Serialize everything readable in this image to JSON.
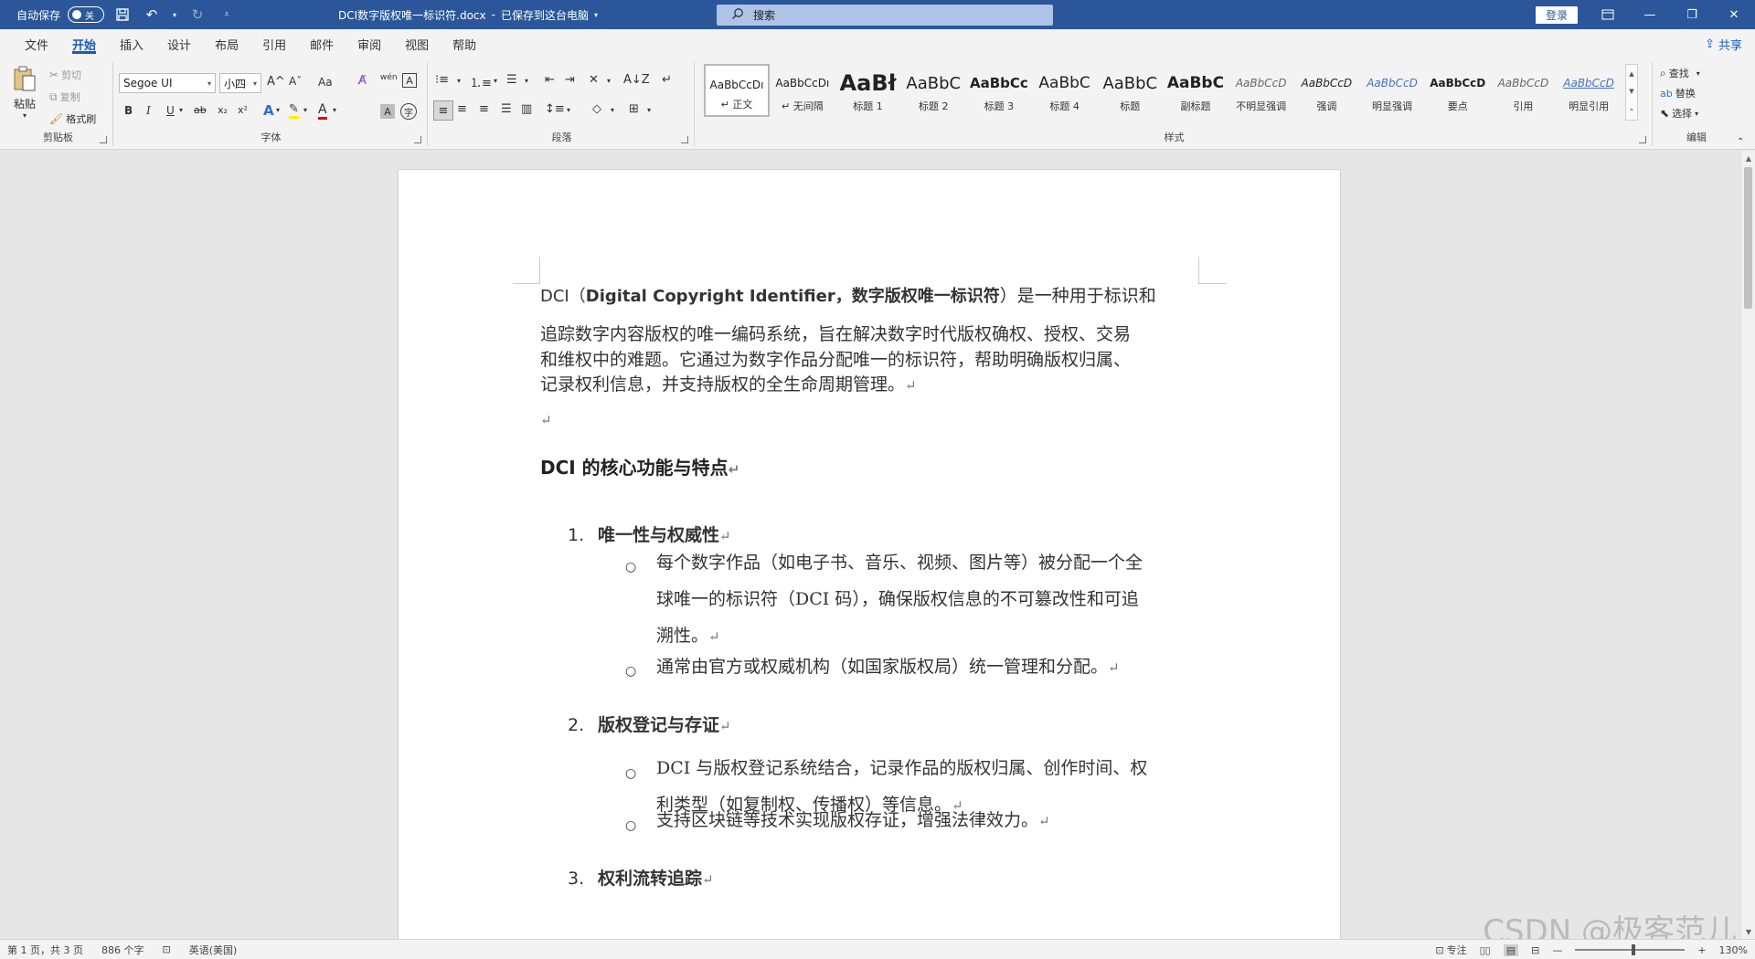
{
  "titlebar": {
    "autosave_label": "自动保存",
    "autosave_state": "关",
    "doc_title": "DCI数字版权唯一标识符.docx",
    "saved_status": "已保存到这台电脑",
    "search_placeholder": "搜索",
    "login_label": "登录"
  },
  "menu": {
    "tabs": [
      "文件",
      "开始",
      "插入",
      "设计",
      "布局",
      "引用",
      "邮件",
      "审阅",
      "视图",
      "帮助"
    ],
    "share_label": "共享"
  },
  "ribbon": {
    "clipboard": {
      "paste": "粘贴",
      "cut": "剪切",
      "copy": "复制",
      "format_painter": "格式刷",
      "label": "剪贴板"
    },
    "font": {
      "font_name": "Segoe UI",
      "font_size": "小四",
      "grow": "A^",
      "shrink": "Aˇ",
      "case": "Aa",
      "bold": "B",
      "italic": "I",
      "underline": "U",
      "strike": "ab",
      "subscript": "x₂",
      "superscript": "x²",
      "label": "字体"
    },
    "paragraph": {
      "label": "段落"
    },
    "styles": {
      "label": "样式",
      "items": [
        {
          "sample": "AaBbCcDı",
          "name": "↵ 正文"
        },
        {
          "sample": "AaBbCcDı",
          "name": "↵ 无间隔"
        },
        {
          "sample": "AaBł",
          "name": "标题 1"
        },
        {
          "sample": "AaBbC",
          "name": "标题 2"
        },
        {
          "sample": "AaBbCc",
          "name": "标题 3"
        },
        {
          "sample": "AaBbC",
          "name": "标题 4"
        },
        {
          "sample": "AaBbC",
          "name": "标题"
        },
        {
          "sample": "AaBbC",
          "name": "副标题"
        },
        {
          "sample": "AaBbCcD",
          "name": "不明显强调"
        },
        {
          "sample": "AaBbCcD",
          "name": "强调"
        },
        {
          "sample": "AaBbCcD",
          "name": "明显强调"
        },
        {
          "sample": "AaBbCcD",
          "name": "要点"
        },
        {
          "sample": "AaBbCcD",
          "name": "引用"
        },
        {
          "sample": "AaBbCcD",
          "name": "明显引用"
        }
      ]
    },
    "editing": {
      "find": "查找",
      "replace": "替换",
      "select": "选择",
      "label": "编辑"
    }
  },
  "document": {
    "intro_prefix": "DCI（",
    "intro_bold": "Digital Copyright Identifier，数字版权唯一标识符",
    "intro_line1_rest": "）是一种用于标识和",
    "intro_line2": "追踪数字内容版权的唯一编码系统，旨在解决数字时代版权确权、授权、交易",
    "intro_line3": "和维权中的难题。它通过为数字作品分配唯一的标识符，帮助明确版权归属、",
    "intro_line4": "记录权利信息，并支持版权的全生命周期管理。",
    "pilcrow": "↵",
    "heading": "DCI 的核心功能与特点",
    "sections": [
      {
        "num": "1.",
        "title": "唯一性与权威性",
        "bullets": [
          {
            "lines": [
              "每个数字作品（如电子书、音乐、视频、图片等）被分配一个全",
              "球唯一的标识符（DCI 码），确保版权信息的不可篡改性和可追",
              "溯性。"
            ]
          },
          {
            "lines": [
              "通常由官方或权威机构（如国家版权局）统一管理和分配。"
            ]
          }
        ]
      },
      {
        "num": "2.",
        "title": "版权登记与存证",
        "bullets": [
          {
            "lines": [
              "DCI 与版权登记系统结合，记录作品的版权归属、创作时间、权",
              "利类型（如复制权、传播权）等信息。"
            ]
          },
          {
            "lines": [
              "支持区块链等技术实现版权存证，增强法律效力。"
            ]
          }
        ]
      },
      {
        "num": "3.",
        "title": "权利流转追踪",
        "bullets": []
      }
    ]
  },
  "statusbar": {
    "page_info": "第 1 页，共 3 页",
    "word_count": "886 个字",
    "language": "英语(美国)",
    "focus": "专注",
    "zoom": "130%"
  },
  "watermark": "CSDN @极客范儿"
}
